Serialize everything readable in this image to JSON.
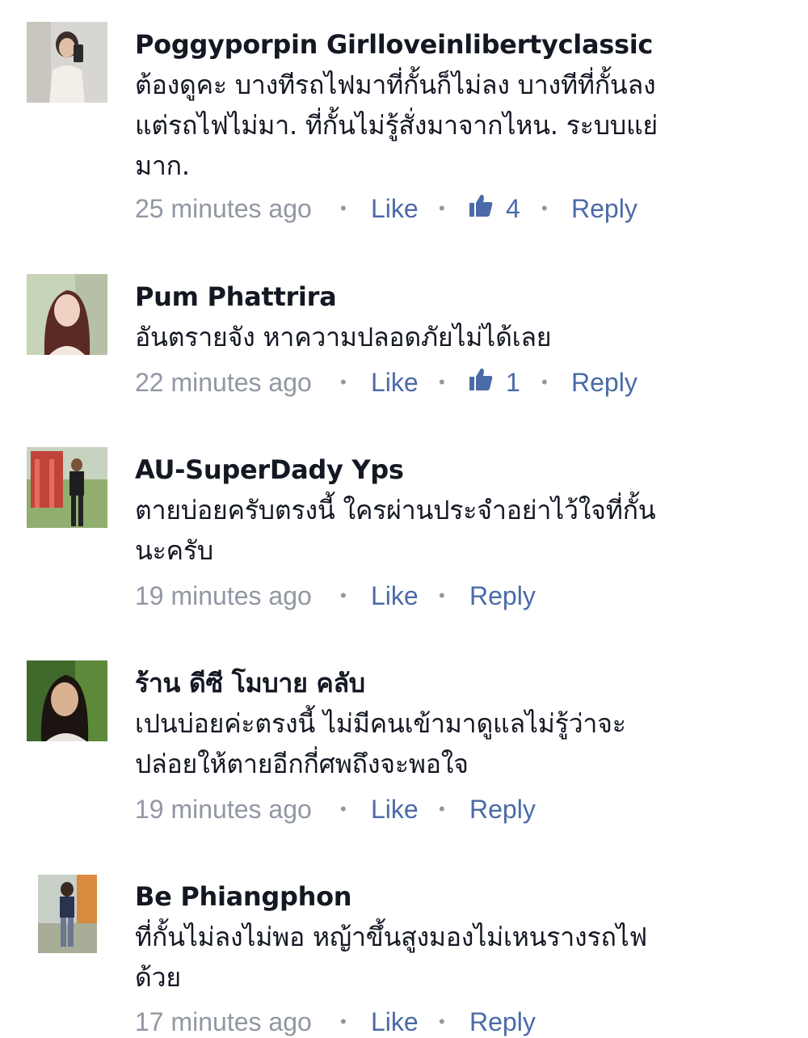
{
  "comments": [
    {
      "author": "Poggyporpin Girlloveinlibertyclassic",
      "lines": [
        "ต้องดูคะ บางทีรถไฟมาที่กั้นก็ไม่ลง บางทีที่กั้นลง",
        "แต่รถไฟไม่มา. ที่กั้นไม่รู้สั่งมาจากไหน. ระบบแย่",
        "มาก."
      ],
      "time": "25 minutes ago",
      "like_label": "Like",
      "reaction_count": "4",
      "reply_label": "Reply",
      "avatar_icon": "user-photo-icon"
    },
    {
      "author": "Pum Phattrira",
      "lines": [
        "อันตรายจัง หาความปลอดภัยไม่ได้เลย"
      ],
      "time": "22 minutes ago",
      "like_label": "Like",
      "reaction_count": "1",
      "reply_label": "Reply",
      "avatar_icon": "user-photo-icon"
    },
    {
      "author": "AU-SuperDady Yps",
      "lines": [
        "ตายบ่อยครับตรงนี้ ใครผ่านประจำอย่าไว้ใจที่กั้น",
        "นะครับ"
      ],
      "time": "19 minutes ago",
      "like_label": "Like",
      "reply_label": "Reply",
      "avatar_icon": "user-photo-icon"
    },
    {
      "author": "ร้าน ดีซี โมบาย คลับ",
      "lines": [
        "เปนบ่อยค่ะตรงนี้  ไม่มีคนเข้ามาดูแลไม่รู้ว่าจะ",
        "ปล่อยให้ตายอีกกี่ศพถึงจะพอใจ"
      ],
      "time": "19 minutes ago",
      "like_label": "Like",
      "reply_label": "Reply",
      "avatar_icon": "user-photo-icon"
    },
    {
      "author": "Be Phiangphon",
      "lines": [
        "ที่กั้นไม่ลงไม่พอ หญ้าขึ้นสูงมองไม่เหนรางรถไฟ",
        "ด้วย"
      ],
      "time": "17 minutes ago",
      "like_label": "Like",
      "reply_label": "Reply",
      "avatar_icon": "user-photo-icon"
    }
  ],
  "separator": "•",
  "colors": {
    "name": "#141823",
    "timestamp": "#9197a3",
    "link": "#4b6aa8",
    "background": "#ffffff"
  }
}
